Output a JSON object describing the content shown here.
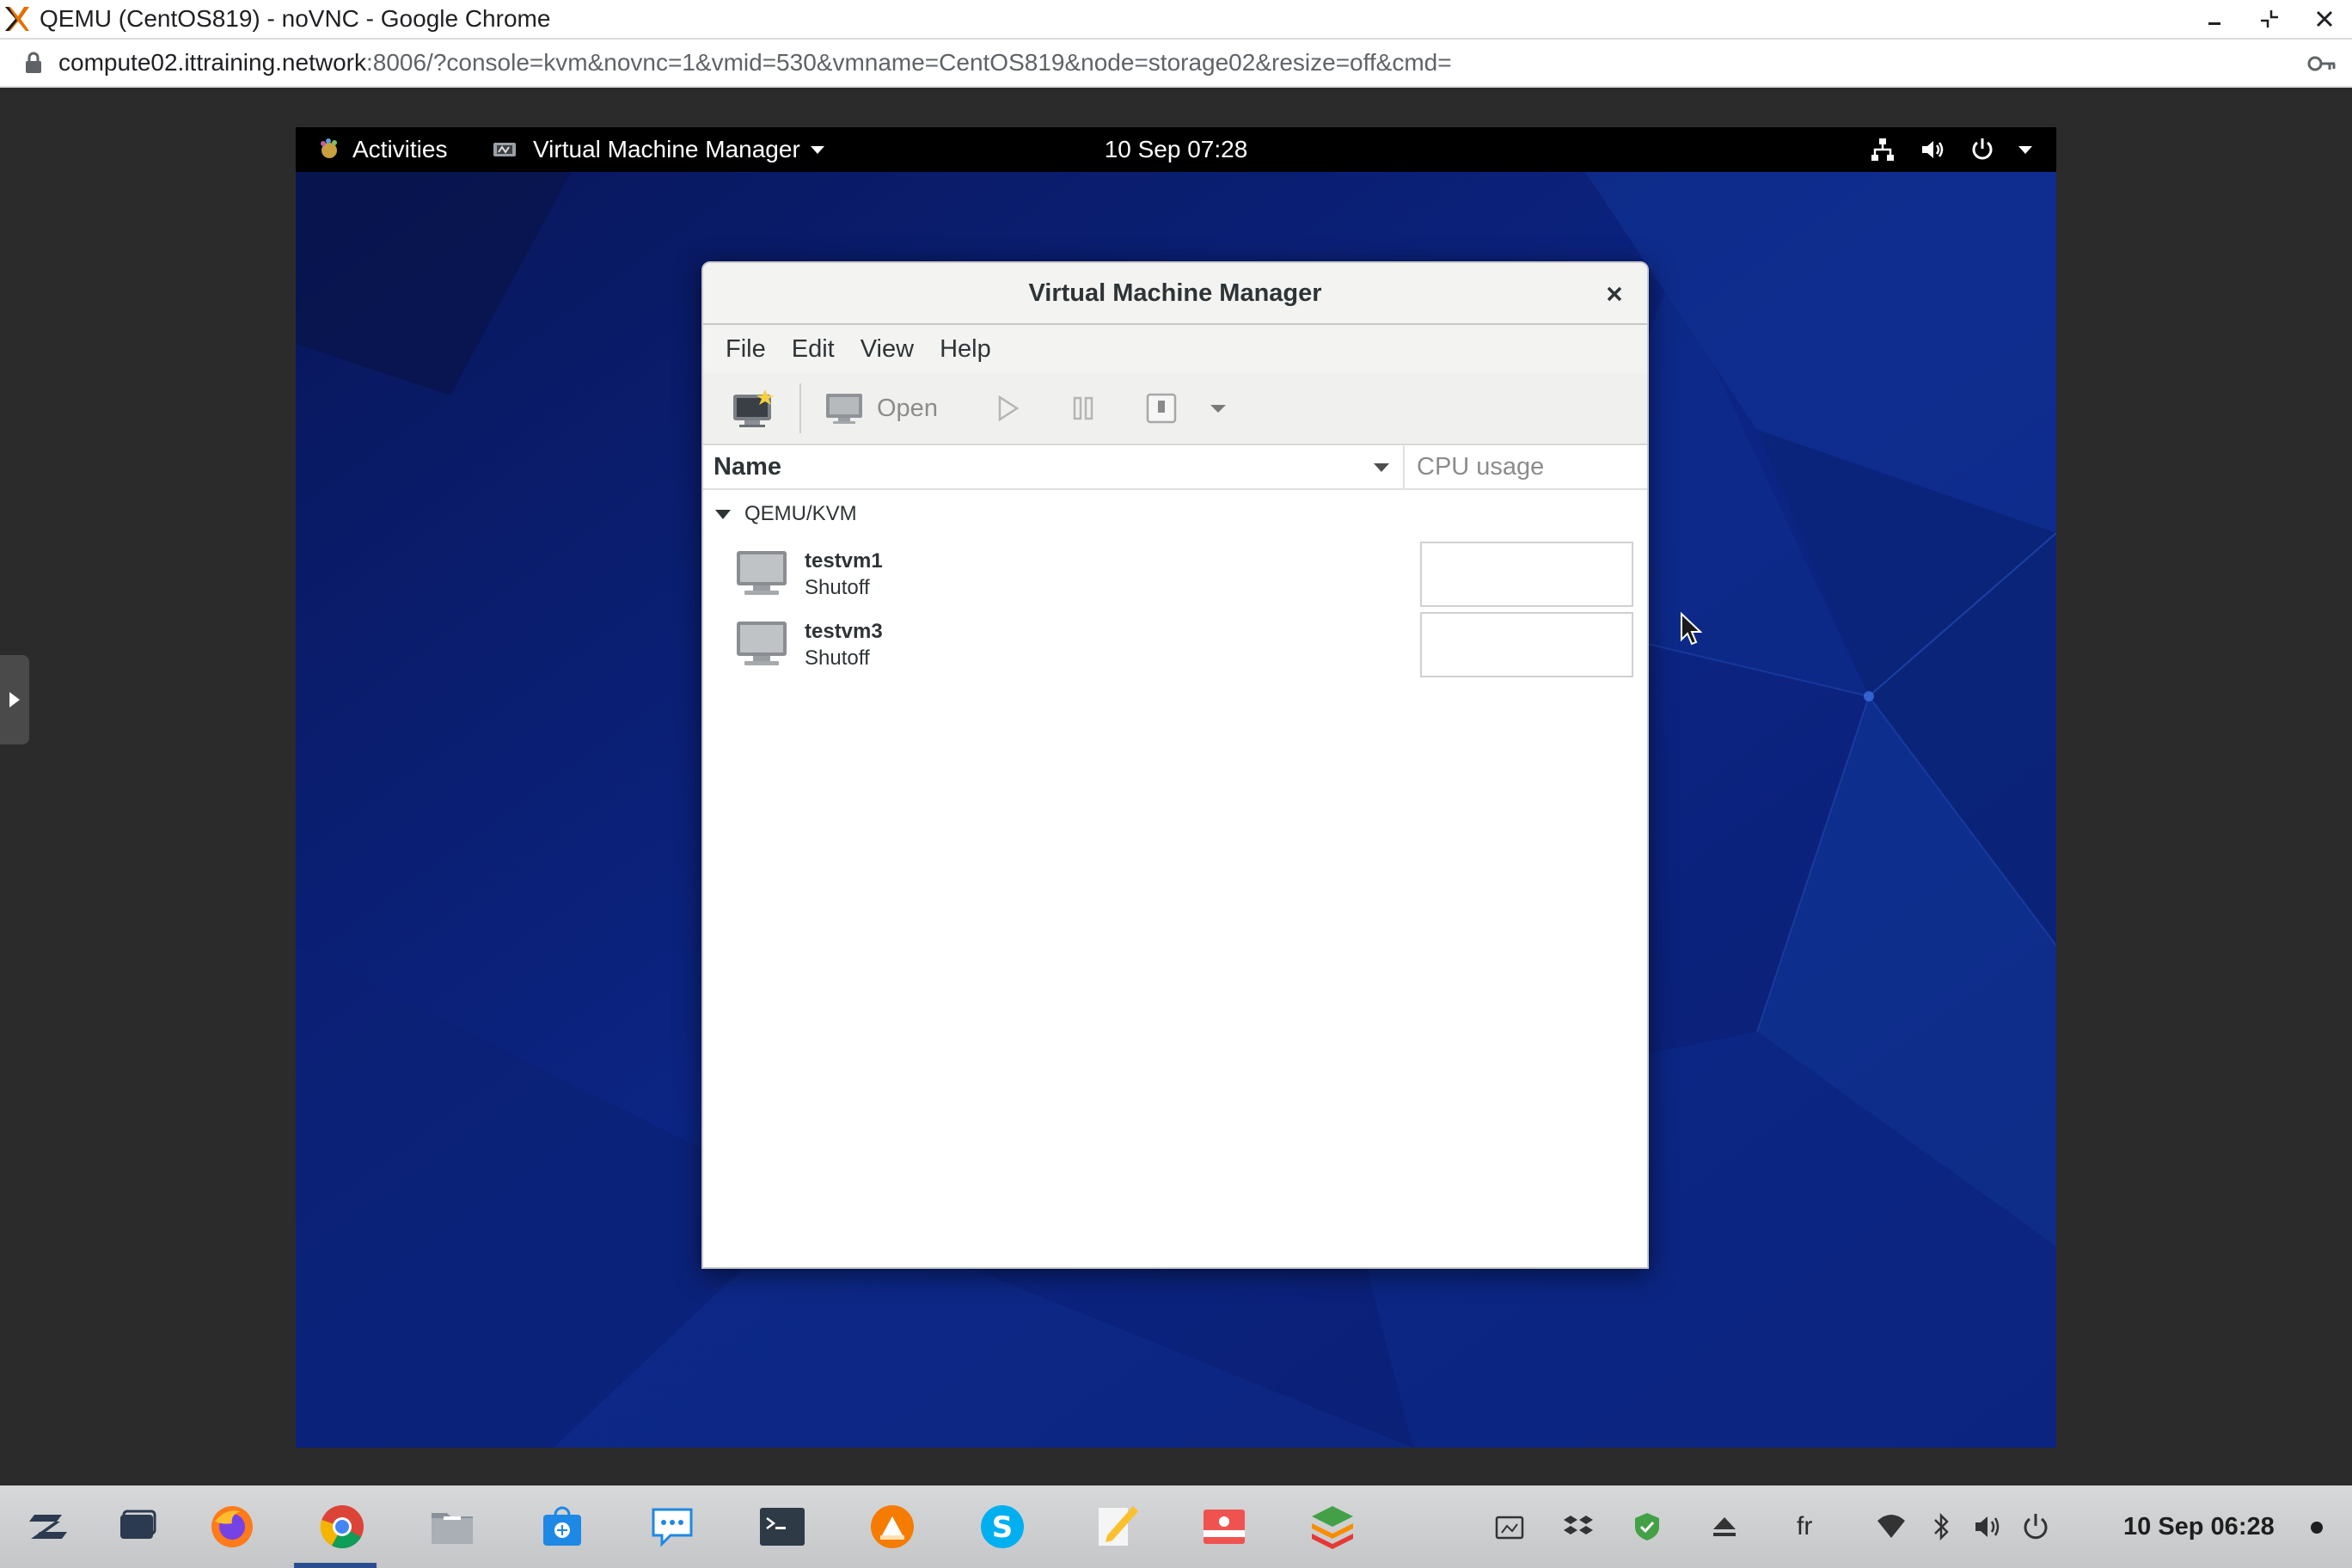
{
  "browser": {
    "window_title": "QEMU (CentOS819) - noVNC - Google Chrome",
    "url_host": "compute02.ittraining.network",
    "url_rest": ":8006/?console=kvm&novnc=1&vmid=530&vmname=CentOS819&node=storage02&resize=off&cmd="
  },
  "gnome": {
    "activities_label": "Activities",
    "app_menu_label": "Virtual Machine Manager",
    "clock": "10 Sep  07:28"
  },
  "vmm": {
    "title": "Virtual Machine Manager",
    "menu": [
      "File",
      "Edit",
      "View",
      "Help"
    ],
    "toolbar": {
      "open_label": "Open"
    },
    "columns": {
      "name": "Name",
      "cpu": "CPU usage"
    },
    "connection": "QEMU/KVM",
    "vms": [
      {
        "name": "testvm1",
        "status": "Shutoff"
      },
      {
        "name": "testvm3",
        "status": "Shutoff"
      }
    ]
  },
  "taskbar": {
    "language": "fr",
    "clock": "10 Sep  06:28"
  },
  "colors": {
    "vm_desktop": "#0a1e6b",
    "gnome_bar": "#000000",
    "taskbar": "#cfd0d2"
  }
}
